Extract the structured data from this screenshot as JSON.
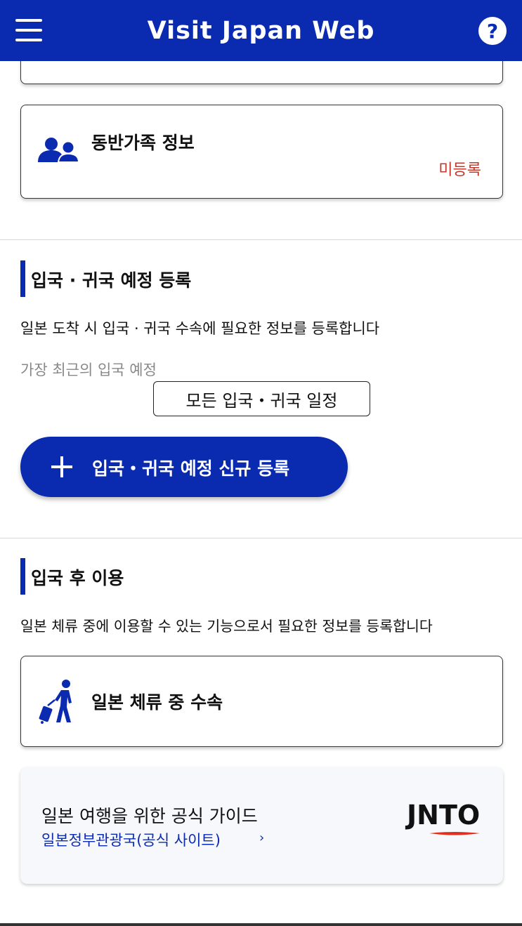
{
  "header": {
    "title": "Visit Japan Web",
    "help_symbol": "?"
  },
  "family_card": {
    "title": "동반가족 정보",
    "status": "미등록",
    "status_color": "#c0392b"
  },
  "entry_section": {
    "title": "입국 · 귀국 예정 등록",
    "description": "일본 도착 시 입국 · 귀국 수속에 필요한 정보를 등록합니다",
    "recent_label": "가장 최근의 입국 예정",
    "all_schedule_button": "모든 입국・귀국 일정",
    "new_registration_button": "입국・귀국 예정 신규 등록"
  },
  "after_entry_section": {
    "title": "입국 후 이용",
    "description": "일본 체류 중에 이용할 수 있는 기능으로서 필요한 정보를 등록합니다",
    "stay_card_title": "일본 체류 중 수속"
  },
  "guide_card": {
    "title": "일본 여행을 위한 공식 가이드",
    "link": "일본정부관광국(공식 사이트)",
    "chevron": "›",
    "logo_text": "JNTO"
  },
  "colors": {
    "brand_blue": "#0a2ab0",
    "alert_red": "#c0392b"
  }
}
